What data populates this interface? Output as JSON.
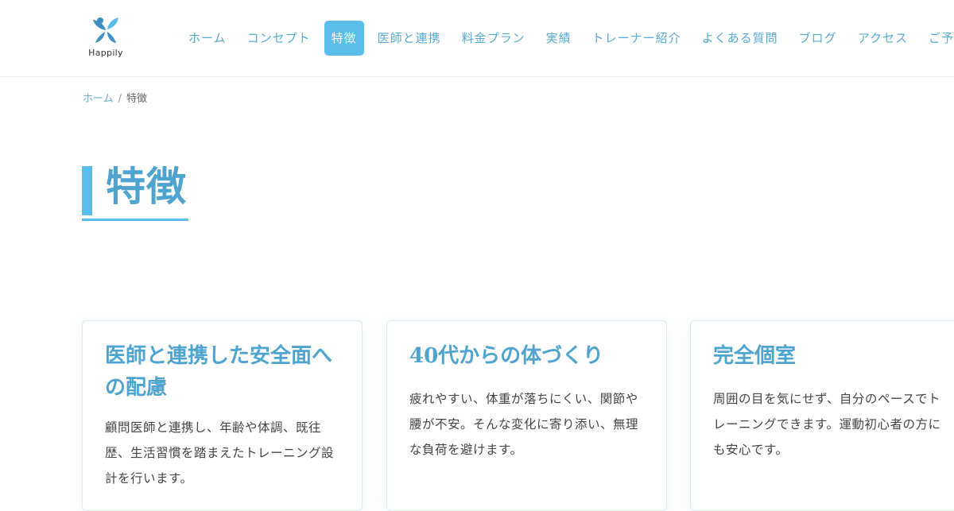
{
  "brand": {
    "logo_text": "Happily",
    "colors": {
      "accent": "#5bbbe9",
      "link": "#5aa9cf",
      "heading": "#4fa3cf",
      "logo": "#3d8fc4"
    }
  },
  "nav": {
    "items": [
      {
        "label": "ホーム"
      },
      {
        "label": "コンセプト"
      },
      {
        "label": "特徴"
      },
      {
        "label": "医師と連携"
      },
      {
        "label": "料金プラン"
      },
      {
        "label": "実績"
      },
      {
        "label": "トレーナー紹介"
      },
      {
        "label": "よくある質問"
      },
      {
        "label": "ブログ"
      },
      {
        "label": "アクセス"
      },
      {
        "label": "ご予約"
      }
    ],
    "active_label": "特徴"
  },
  "breadcrumb": {
    "home": "ホーム",
    "separator": "/",
    "current": "特徴"
  },
  "page": {
    "title": "特徴"
  },
  "features": [
    {
      "title": "医師と連携した安全面への配慮",
      "text": "顧問医師と連携し、年齢や体調、既往歴、生活習慣を踏まえたトレーニング設計を行います。"
    },
    {
      "title": "40代からの体づくり",
      "text": "疲れやすい、体重が落ちにくい、関節や腰が不安。そんな変化に寄り添い、無理な負荷を避けます。"
    },
    {
      "title": "完全個室",
      "text": "周囲の目を気にせず、自分のペースでトレーニングできます。運動初心者の方にも安心です。"
    }
  ]
}
